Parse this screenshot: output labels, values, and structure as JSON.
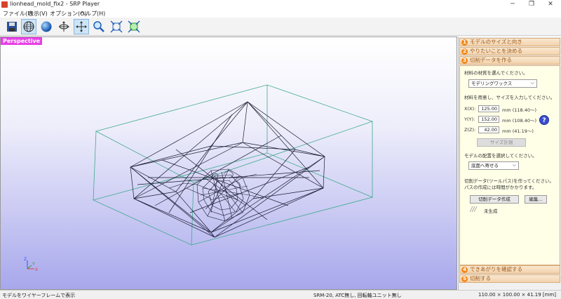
{
  "window": {
    "title": "lionhead_mold_fix2 - SRP Player"
  },
  "menu": [
    "ファイル(F)",
    "表示(V)",
    "オプション(O)",
    "ヘルプ(H)"
  ],
  "viewport": {
    "label": "Perspective"
  },
  "steps": {
    "step1": {
      "num": "1",
      "label": "モデルのサイズと向き"
    },
    "step2": {
      "num": "2",
      "label": "やりたいことを決める"
    },
    "step3": {
      "num": "3",
      "label": "切削データを作る"
    },
    "step4": {
      "num": "4",
      "label": "できあがりを確認する"
    },
    "step5": {
      "num": "5",
      "label": "切削する"
    }
  },
  "panel": {
    "material_prompt": "材料の材質を選んでください。",
    "material_value": "モデリングワックス",
    "size_prompt": "材料を用意し、サイズを入力してください。",
    "x_label": "X(X):",
    "x_value": "125.00",
    "x_hint": "mm  (118.40～)",
    "y_label": "Y(Y):",
    "y_value": "152.00",
    "y_hint": "mm  (108.40～)",
    "z_label": "Z(Z):",
    "z_value": "42.00",
    "z_hint": "mm  (41.19～)",
    "help": "?",
    "measure_button": "サイズ計測",
    "placement_prompt": "モデルの配置を選択してください。",
    "placement_value": "底面へ寄せる",
    "toolpath_prompt_1": "切削データ(ツールパス)を作ってください。",
    "toolpath_prompt_2": "パスの作成には時間がかかります。",
    "create_button": "切削データ作成",
    "edit_button": "編集...",
    "status": "未生成"
  },
  "statusbar": {
    "left": "モデルをワイヤーフレームで表示",
    "middle": "SRM-20, ATC無し, 回転軸ユニット無し",
    "right": "110.00 × 100.00 × 41.19 [mm]"
  },
  "icons": [
    "save-icon",
    "wireframe-sphere-icon",
    "shaded-sphere-icon",
    "rotate-icon",
    "pan-icon",
    "zoom-icon",
    "fit-icon",
    "fit-all-icon"
  ]
}
